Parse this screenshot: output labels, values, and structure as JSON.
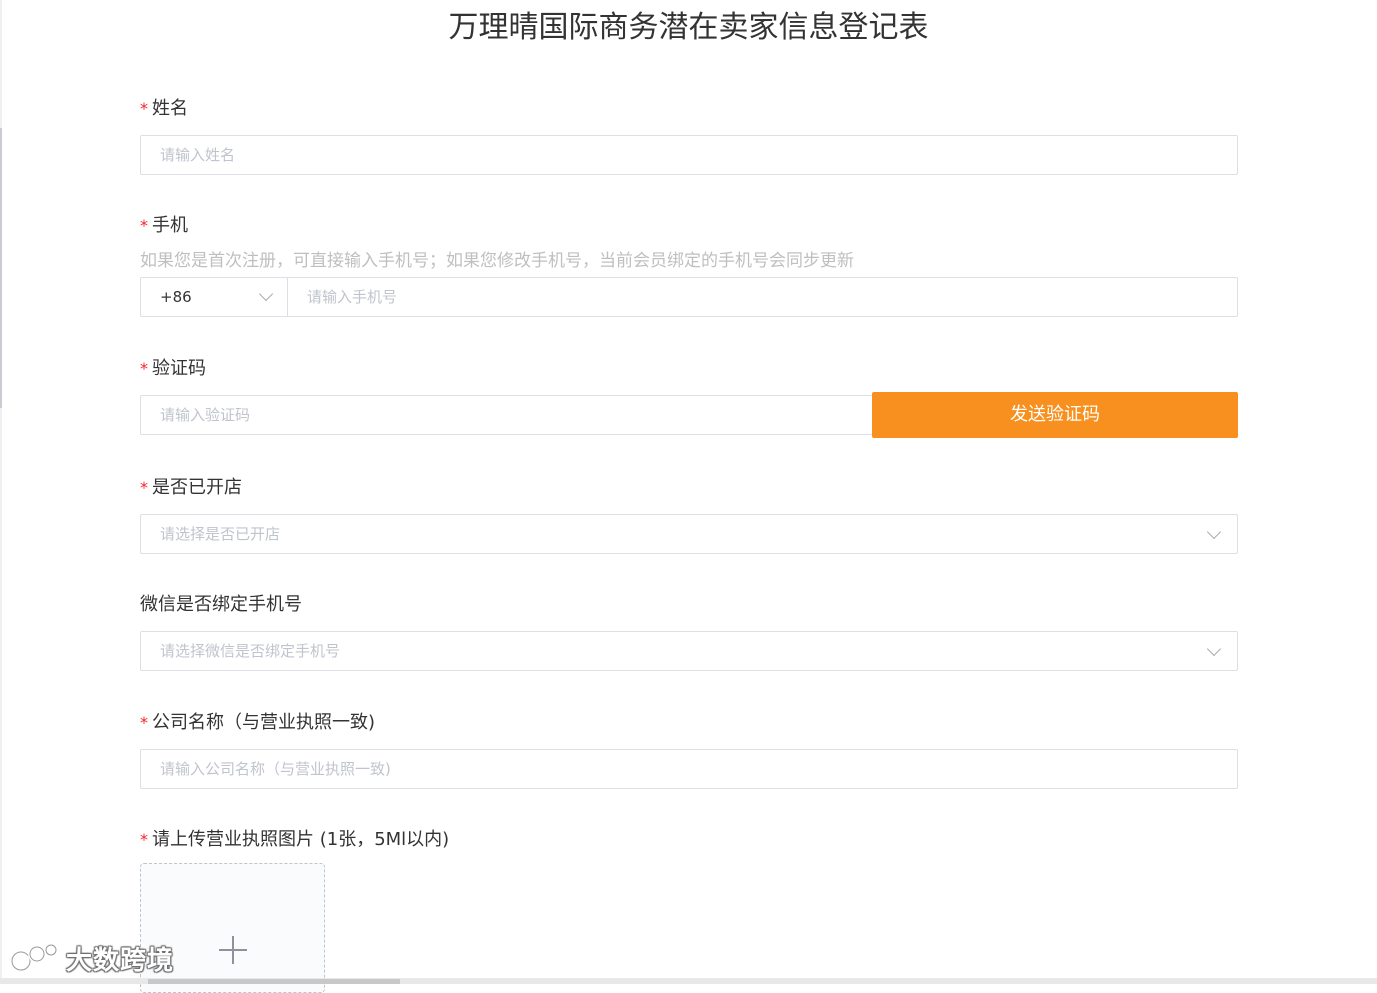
{
  "page": {
    "title": "万理晴国际商务潜在卖家信息登记表"
  },
  "form": {
    "name": {
      "required_mark": "*",
      "label": "姓名",
      "placeholder": "请输入姓名"
    },
    "phone": {
      "required_mark": "*",
      "label": "手机",
      "hint": "如果您是首次注册，可直接输入手机号；如果您修改手机号，当前会员绑定的手机号会同步更新",
      "country_code": "+86",
      "placeholder": "请输入手机号"
    },
    "verification_code": {
      "required_mark": "*",
      "label": "验证码",
      "placeholder": "请输入验证码",
      "send_button": "发送验证码"
    },
    "store_opened": {
      "required_mark": "*",
      "label": "是否已开店",
      "placeholder": "请选择是否已开店"
    },
    "wechat_bound": {
      "label": "微信是否绑定手机号",
      "placeholder": "请选择微信是否绑定手机号"
    },
    "company_name": {
      "required_mark": "*",
      "label": "公司名称（与营业执照一致)",
      "placeholder": "请输入公司名称（与营业执照一致)"
    },
    "license_upload": {
      "required_mark": "*",
      "label": "请上传营业执照图片 (1张，5Ml以内)"
    }
  },
  "watermark": {
    "text": "大数跨境"
  },
  "colors": {
    "accent": "#f7901e",
    "required": "#f5222d",
    "border": "#dcdfe6",
    "placeholder": "#c0c4cc",
    "hint": "#bfbfbf"
  },
  "icons": {
    "dropdown": "chevron-down-icon",
    "upload": "plus-icon"
  }
}
